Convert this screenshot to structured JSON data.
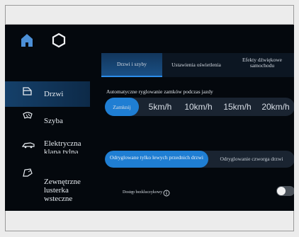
{
  "tabs": [
    {
      "label": "Drzwi i szyby",
      "active": true
    },
    {
      "label": "Ustawienia oświetlenia",
      "active": false
    },
    {
      "label": "Efekty dźwiękowe samochodu",
      "active": false
    }
  ],
  "sidebar": {
    "items": [
      {
        "label": "Drzwi",
        "icon": "door-icon",
        "active": true
      },
      {
        "label": "Szyba",
        "icon": "windshield-icon",
        "active": false
      },
      {
        "label": "Elektryczna klapa tylna",
        "icon": "tailgate-icon",
        "active": false
      },
      {
        "label": "Zewnętrzne lusterka wsteczne",
        "icon": "side-mirror-icon",
        "active": false
      }
    ]
  },
  "auto_lock": {
    "title": "Automatyczne ryglowanie zamków podczas jazdy",
    "options": [
      "Zamknij",
      "5km/h",
      "10km/h",
      "15km/h",
      "20km/h"
    ],
    "selected_index": 0
  },
  "unlock": {
    "options": [
      "Odryglowane tylko lewych przednich drzwi",
      "Odryglowanie czworga drzwi"
    ],
    "selected_index": 0
  },
  "keyless": {
    "label": "Dostęp bezkluczykowy",
    "enabled": false
  },
  "colors": {
    "accent": "#1f7ed3",
    "background": "#04080d",
    "panel": "#1a2431"
  }
}
